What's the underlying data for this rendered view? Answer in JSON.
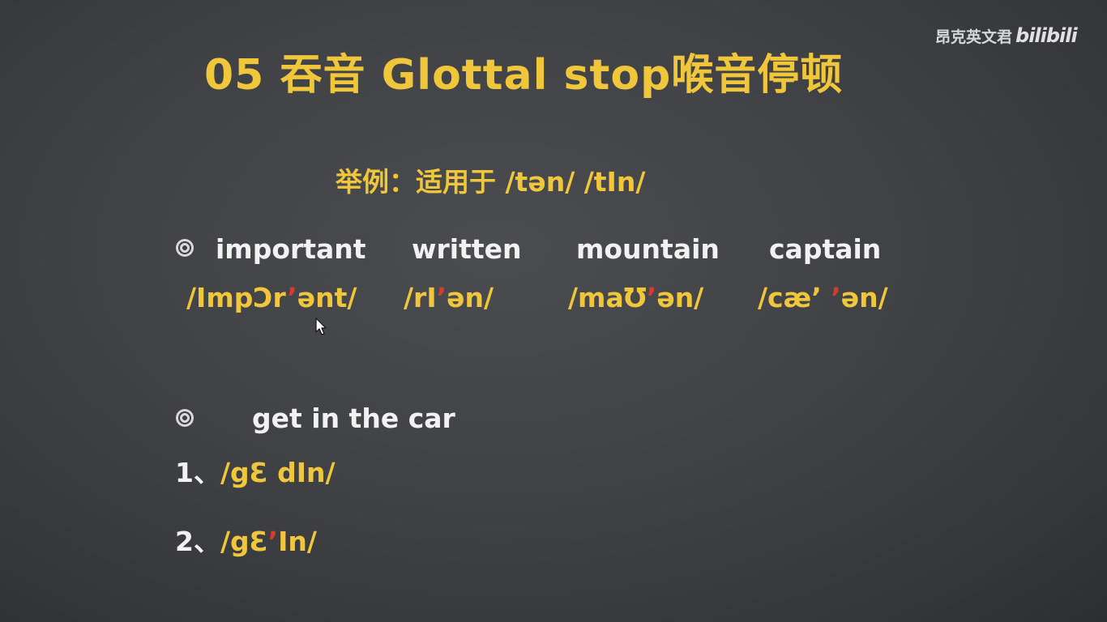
{
  "watermark": {
    "channel": "昂克英文君",
    "logo": "bilibili"
  },
  "title": "05 吞音 Glottal stop喉音停顿",
  "subtitle": "举例：适用于 /tən/ /tIn/",
  "words": [
    "important",
    "written",
    "mountain",
    "captain"
  ],
  "ipa": [
    {
      "before": "/ImpƆr",
      "mark": "’",
      "after": "ənt/"
    },
    {
      "before": "/rI",
      "mark": "’",
      "after": "ən/"
    },
    {
      "before": "/maƱ",
      "mark": "’",
      "after": "ən/"
    },
    {
      "before": "/cæ’",
      "mark": " ’",
      "after": "ən/"
    }
  ],
  "example": {
    "phrase": "get in the car",
    "options": [
      {
        "number": "1、",
        "before": "/gƐ dIn/",
        "mark": "",
        "after": ""
      },
      {
        "number": "2、",
        "before": "/gƐ",
        "mark": "’",
        "after": "In/"
      }
    ]
  },
  "icons": {
    "bullet": "bullet-swirl-icon",
    "cursor": "mouse-cursor-icon"
  },
  "colors": {
    "accent": "#f0c63a",
    "mark": "#d83b2b",
    "text": "#f2f2f2",
    "board": "#404246"
  }
}
